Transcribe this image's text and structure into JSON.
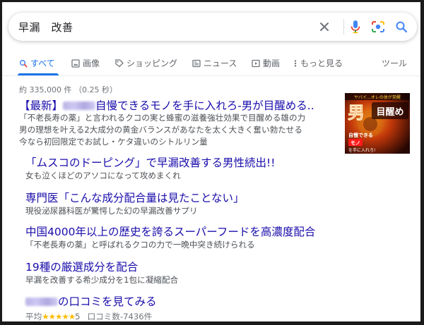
{
  "search": {
    "query": "早漏　改善"
  },
  "icons": {
    "clear": "close-icon",
    "voice": "microphone-icon",
    "lens": "camera-icon",
    "search": "search-icon"
  },
  "colors": {
    "link": "#1a0dab",
    "accent": "#1a73e8",
    "text": "#4d5156",
    "muted": "#70757a",
    "star": "#fbbc04"
  },
  "tabs": [
    {
      "label": "すべて",
      "icon": "search-icon",
      "active": true
    },
    {
      "label": "画像",
      "icon": "image-icon"
    },
    {
      "label": "ショッピング",
      "icon": "tag-icon"
    },
    {
      "label": "ニュース",
      "icon": "news-icon"
    },
    {
      "label": "動画",
      "icon": "video-icon"
    },
    {
      "label": "もっと見る",
      "icon": "more-icon"
    },
    {
      "label": "ツール"
    }
  ],
  "result_stats": "約 335,000 件 （0.25 秒）",
  "result": {
    "title_prefix": "【最新】",
    "title_suffix": "自慢できるモノを手に入れろ-男が目醒める..",
    "snippet": [
      "「不老長寿の薬」と言われるクコの実と蜂蜜の滋養強壮効果で目醒める雄の力",
      "男の理想を叶える2大成分の黄金バランスがあなたを太く大きく奮い勃たせる",
      "今なら初回限定でお試し・ケタ違いのシトルリン量"
    ],
    "thumbnail": {
      "top_text": "ヤバイ…オレの体が覚醒",
      "big_left": "男",
      "big_right": "目醒め",
      "line1": "自慢できる",
      "line2": "モノ",
      "line3": "を手に入れろ!"
    }
  },
  "sitelinks": [
    {
      "title": "「ムスコのドーピング」で早漏改善する男性続出!!",
      "desc": "女も泣くほどのアソコになって攻めまくれ"
    },
    {
      "title": "専門医「こんな成分配合量は見たことない」",
      "desc": "現役泌尿器科医が驚愕した幻の早漏改善サプリ"
    },
    {
      "title": "中国4000年以上の歴史を誇るスーパーフードを高濃度配合",
      "desc": "「不老長寿の薬」と呼ばれるクコの力で一晩中突き続けられる"
    },
    {
      "title": "19種の厳選成分を配合",
      "desc": "早漏を改善する希少成分を1包に凝縮配合"
    },
    {
      "title": "の口コミを見てみる",
      "desc": ""
    }
  ],
  "rating": {
    "prefix": "平均",
    "stars": "★★★★★",
    "score": "5",
    "reviews": "口コミ数-7436件",
    "value": 5,
    "max": 5
  }
}
